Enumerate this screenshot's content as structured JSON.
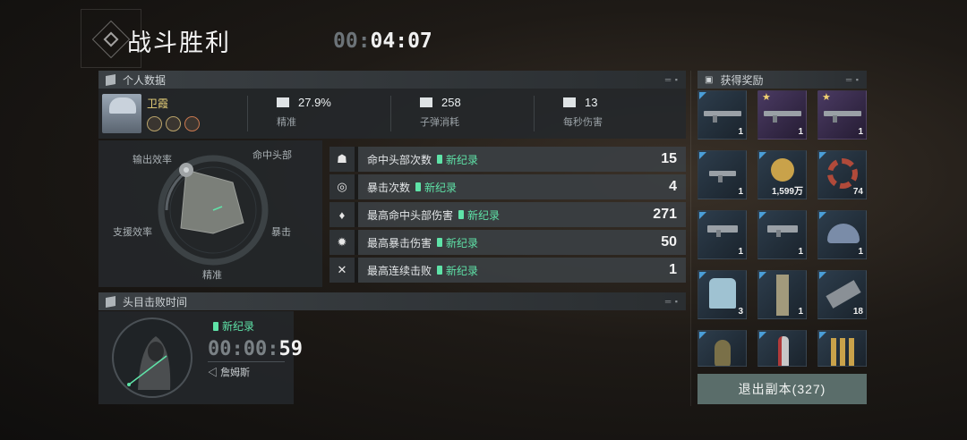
{
  "header": {
    "title": "战斗胜利",
    "timer_dim": "00:",
    "timer_hi": "04:07"
  },
  "personal": {
    "section": "个人数据",
    "player": "卫霞",
    "stats": [
      {
        "value": "27.9%",
        "label": "精准",
        "icon": "crosshair-icon"
      },
      {
        "value": "258",
        "label": "子弹消耗",
        "icon": "ammo-icon"
      },
      {
        "value": "13",
        "label": "每秒伤害",
        "icon": "arrow-icon"
      }
    ]
  },
  "radar": {
    "labels": [
      "输出效率",
      "命中头部",
      "暴击",
      "精准",
      "支援效率"
    ]
  },
  "records": [
    {
      "label": "命中头部次数",
      "tag": "新纪录",
      "value": "15",
      "icon": "headshot-icon"
    },
    {
      "label": "暴击次数",
      "tag": "新纪录",
      "value": "4",
      "icon": "crit-icon"
    },
    {
      "label": "最高命中头部伤害",
      "tag": "新纪录",
      "value": "271",
      "icon": "flame-icon"
    },
    {
      "label": "最高暴击伤害",
      "tag": "新纪录",
      "value": "50",
      "icon": "fire-icon"
    },
    {
      "label": "最高连续击败",
      "tag": "新纪录",
      "value": "1",
      "icon": "swords-icon"
    }
  ],
  "boss": {
    "section": "头目击败时间",
    "tag": "新纪录",
    "time_dim": "00:00:",
    "time_hi": "59",
    "name": "詹姆斯"
  },
  "rewards": {
    "section": "获得奖励",
    "exit_label": "退出副本(327)",
    "items": [
      {
        "type": "rifle",
        "rarity": "blue",
        "count": "1"
      },
      {
        "type": "rifle",
        "rarity": "purple",
        "count": "1",
        "star": true
      },
      {
        "type": "rifle",
        "rarity": "purple",
        "count": "1",
        "star": true
      },
      {
        "type": "smg",
        "rarity": "blue",
        "count": "1"
      },
      {
        "type": "rank-badge",
        "rarity": "blue",
        "count": "1,599万"
      },
      {
        "type": "gear",
        "rarity": "blue",
        "count": "74"
      },
      {
        "type": "pistol",
        "rarity": "blue",
        "count": "1"
      },
      {
        "type": "pistol",
        "rarity": "blue",
        "count": "1"
      },
      {
        "type": "hat",
        "rarity": "blue",
        "count": "1"
      },
      {
        "type": "shirt",
        "rarity": "blue",
        "count": "3"
      },
      {
        "type": "pants",
        "rarity": "blue",
        "count": "1"
      },
      {
        "type": "metal",
        "rarity": "blue",
        "count": "18"
      },
      {
        "type": "grenade",
        "rarity": "blue",
        "count": ""
      },
      {
        "type": "spray",
        "rarity": "blue",
        "count": ""
      },
      {
        "type": "bullets",
        "rarity": "blue",
        "count": ""
      }
    ]
  }
}
